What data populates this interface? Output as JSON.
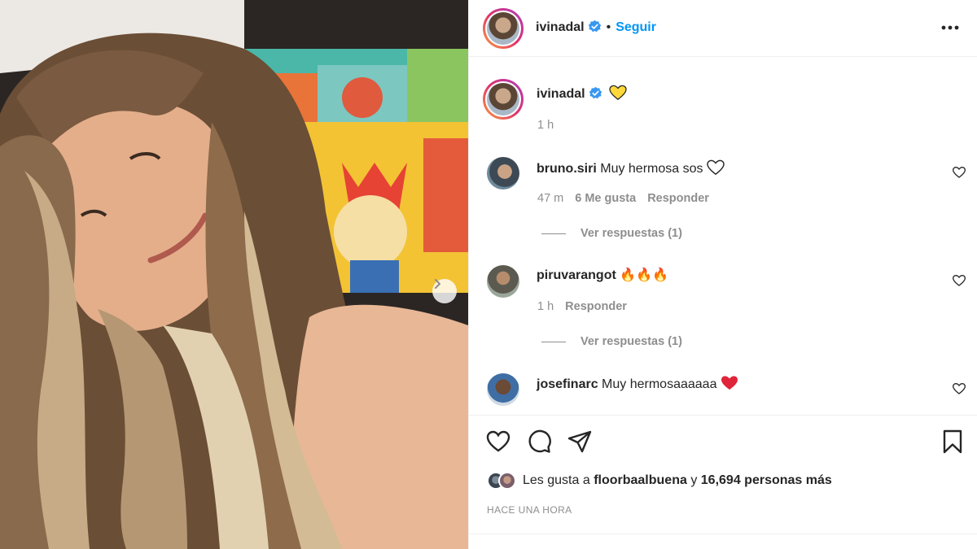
{
  "post": {
    "author": "ivinadal",
    "follow_label": "Seguir",
    "separator": "•",
    "more_label": "•••",
    "caption_emoji": "💛",
    "caption_time": "1 h"
  },
  "comments": [
    {
      "user": "bruno.siri",
      "text": "Muy hermosa sos",
      "emoji": "♡",
      "time": "47 m",
      "likes": "6 Me gusta",
      "reply_label": "Responder",
      "replies": "Ver respuestas (1)"
    },
    {
      "user": "piruvarangot",
      "text": "",
      "emoji": "🔥🔥🔥",
      "time": "1 h",
      "likes": "",
      "reply_label": "Responder",
      "replies": "Ver respuestas (1)"
    },
    {
      "user": "josefinarc",
      "text": "Muy hermosaaaaaa",
      "emoji": "❤️",
      "time": "",
      "likes": "",
      "reply_label": "",
      "replies": ""
    }
  ],
  "likes": {
    "prefix": "Les gusta a",
    "user": "floorbaalbuena",
    "connector": "y",
    "count": "16,694 personas más"
  },
  "timestamp": "HACE UNA HORA",
  "icons": [
    "heart-icon",
    "comment-icon",
    "share-icon",
    "bookmark-icon",
    "chevron-right-icon",
    "verified-icon",
    "more-icon"
  ],
  "colors": {
    "accent": "#0095f6",
    "verified": "#3897f0",
    "heart_red": "#ed4956",
    "fire": "#f2711c"
  }
}
